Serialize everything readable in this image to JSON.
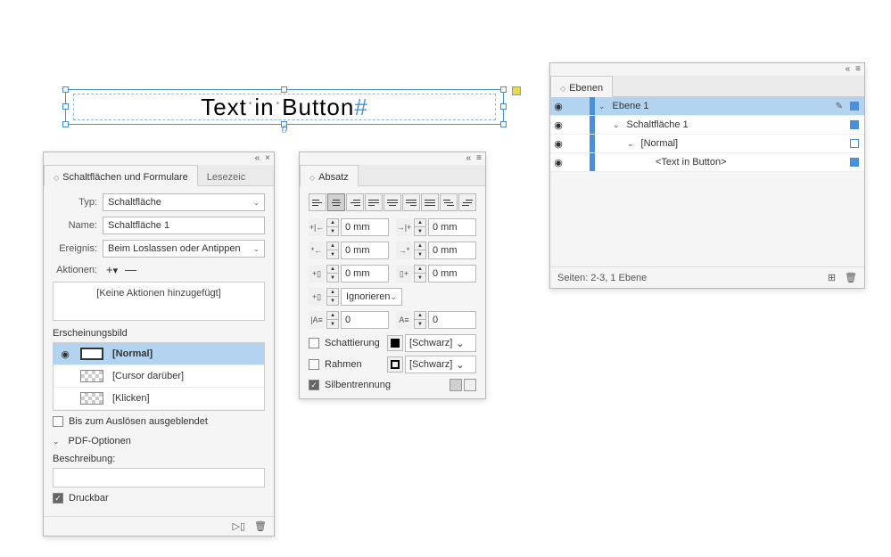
{
  "canvas": {
    "text_parts": [
      "Text",
      "in",
      "Button"
    ],
    "overset_glyph": "0"
  },
  "buttons_panel": {
    "tab1": "Schaltflächen und Formulare",
    "tab2": "Lesezeic",
    "type_label": "Typ:",
    "type_value": "Schaltfläche",
    "name_label": "Name:",
    "name_value": "Schaltfläche 1",
    "event_label": "Ereignis:",
    "event_value": "Beim Loslassen oder Antippen",
    "actions_label": "Aktionen:",
    "no_actions": "[Keine Aktionen hinzugefügt]",
    "appearance_header": "Erscheinungsbild",
    "states": {
      "normal": "[Normal]",
      "rollover": "[Cursor darüber]",
      "click": "[Klicken]"
    },
    "hidden_until": "Bis zum Auslösen ausgeblendet",
    "pdf_options": "PDF-Optionen",
    "description_label": "Beschreibung:",
    "printable": "Druckbar"
  },
  "absatz_panel": {
    "tab": "Absatz",
    "indent_left": "0 mm",
    "indent_right": "0 mm",
    "first_line": "0 mm",
    "last_line": "0 mm",
    "space_before": "0 mm",
    "space_after": "0 mm",
    "dropcap_label": "Ignorieren",
    "lines1": "0",
    "lines2": "0",
    "shading": "Schattierung",
    "frame": "Rahmen",
    "color": "[Schwarz]",
    "hyphen": "Silbentrennung"
  },
  "ebenen_panel": {
    "tab": "Ebenen",
    "items": [
      {
        "name": "Ebene 1",
        "indent": 0,
        "selected": true,
        "expand": true,
        "pen": true,
        "fill": true
      },
      {
        "name": "Schaltfläche 1",
        "indent": 1,
        "selected": false,
        "expand": true,
        "pen": false,
        "fill": true
      },
      {
        "name": "[Normal]",
        "indent": 2,
        "selected": false,
        "expand": true,
        "pen": false,
        "fill": false
      },
      {
        "name": "<Text in Button>",
        "indent": 3,
        "selected": false,
        "expand": false,
        "pen": false,
        "fill": true
      }
    ],
    "footer": "Seiten: 2-3, 1 Ebene"
  }
}
